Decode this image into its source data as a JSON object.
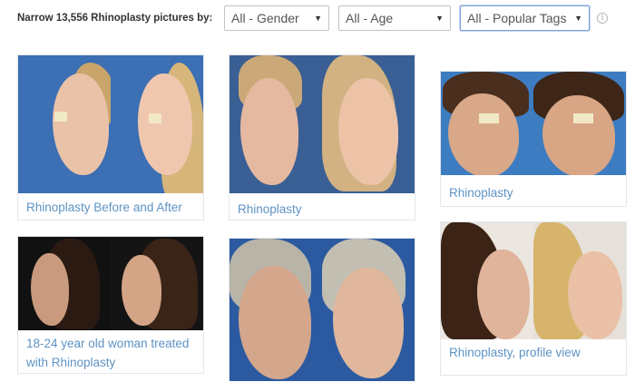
{
  "filter": {
    "label": "Narrow 13,556 Rhinoplasty pictures by:",
    "gender": "All - Gender",
    "age": "All - Age",
    "tags": "All - Popular Tags",
    "info_icon": "info-icon"
  },
  "gallery": [
    {
      "caption": "Rhinoplasty Before and After",
      "bg": "#3c6fb3"
    },
    {
      "caption": "Rhinoplasty",
      "bg": "#3a5f94"
    },
    {
      "caption": "Rhinoplasty",
      "bg": "#3d7cc0"
    },
    {
      "caption": "18-24 year old woman treated with Rhinoplasty",
      "bg": "#111111"
    },
    {
      "caption": "",
      "bg": "#2c5aa0"
    },
    {
      "caption": "Rhinoplasty, profile view",
      "bg": "#e8e3dc"
    }
  ],
  "colors": {
    "link": "#5d93c4",
    "border": "#e3e6ea",
    "active_select": "#7aa0d6"
  }
}
